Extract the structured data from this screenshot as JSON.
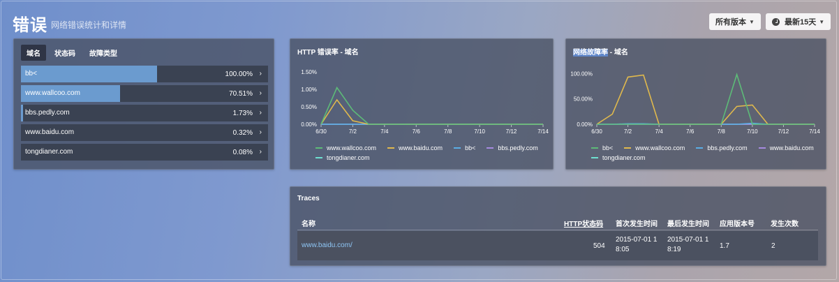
{
  "header": {
    "title": "错误",
    "subtitle": "网络错误统计和详情"
  },
  "controls": {
    "version_label": "所有版本",
    "range_label": "最新15天"
  },
  "domain_panel": {
    "tabs": [
      "域名",
      "状态码",
      "故障类型"
    ],
    "rows": [
      {
        "label": "bb<",
        "percent": "100.00%",
        "fraction": 0.55
      },
      {
        "label": "www.wallcoo.com",
        "percent": "70.51%",
        "fraction": 0.4
      },
      {
        "label": "bbs.pedly.com",
        "percent": "1.73%",
        "fraction": 0.008
      },
      {
        "label": "www.baidu.com",
        "percent": "0.32%",
        "fraction": 0
      },
      {
        "label": "tongdianer.com",
        "percent": "0.08%",
        "fraction": 0
      }
    ]
  },
  "chart_http": {
    "title": "HTTP 错误率 - 域名"
  },
  "chart_net": {
    "title_highlight": "网络故障率",
    "title_rest": " - 域名"
  },
  "chart_data": [
    {
      "type": "line",
      "title": "HTTP 错误率 - 域名",
      "x": [
        "6/30",
        "7/1",
        "7/2",
        "7/3",
        "7/4",
        "7/5",
        "7/6",
        "7/7",
        "7/8",
        "7/9",
        "7/10",
        "7/11",
        "7/12",
        "7/13",
        "7/14"
      ],
      "x_ticks": [
        "6/30",
        "7/2",
        "7/4",
        "7/6",
        "7/8",
        "7/10",
        "7/12",
        "7/14"
      ],
      "y_ticks": [
        "0.00%",
        "0.50%",
        "1.00%",
        "1.50%"
      ],
      "ylim": [
        0,
        1.6
      ],
      "series": [
        {
          "name": "www.wallcoo.com",
          "color": "#5dbb78",
          "values": [
            0,
            1.05,
            0.4,
            0,
            0,
            0,
            0,
            0,
            0,
            0,
            0,
            0,
            0,
            0,
            0
          ]
        },
        {
          "name": "www.baidu.com",
          "color": "#e0b94d",
          "values": [
            0,
            0.7,
            0.1,
            0,
            0,
            0,
            0,
            0,
            0,
            0,
            0,
            0,
            0,
            0,
            0
          ]
        },
        {
          "name": "bb<",
          "color": "#5aaee6",
          "values": [
            0,
            0,
            0,
            0,
            0,
            0,
            0,
            0,
            0,
            0,
            0,
            0,
            0,
            0,
            0
          ]
        },
        {
          "name": "bbs.pedly.com",
          "color": "#a68ae0",
          "values": [
            0,
            0,
            0,
            0,
            0,
            0,
            0,
            0,
            0,
            0,
            0,
            0,
            0,
            0,
            0
          ]
        },
        {
          "name": "tongdianer.com",
          "color": "#6ee0d0",
          "values": [
            0,
            0,
            0,
            0,
            0,
            0,
            0,
            0,
            0,
            0,
            0,
            0,
            0,
            0,
            0
          ]
        }
      ]
    },
    {
      "type": "line",
      "title": "网络故障率 - 域名",
      "x": [
        "6/30",
        "7/1",
        "7/2",
        "7/3",
        "7/4",
        "7/5",
        "7/6",
        "7/7",
        "7/8",
        "7/9",
        "7/10",
        "7/11",
        "7/12",
        "7/13",
        "7/14"
      ],
      "x_ticks": [
        "6/30",
        "7/2",
        "7/4",
        "7/6",
        "7/8",
        "7/10",
        "7/12",
        "7/14"
      ],
      "y_ticks": [
        "0.00%",
        "50.00%",
        "100.00%"
      ],
      "ylim": [
        0,
        110
      ],
      "series": [
        {
          "name": "bb<",
          "color": "#5dbb78",
          "values": [
            0,
            0,
            0,
            0,
            0,
            0,
            0,
            0,
            0,
            98,
            0,
            0,
            0,
            0,
            0
          ]
        },
        {
          "name": "www.wallcoo.com",
          "color": "#e0b94d",
          "values": [
            0,
            20,
            93,
            97,
            0,
            0,
            0,
            0,
            0,
            35,
            38,
            0,
            0,
            0,
            0
          ]
        },
        {
          "name": "bbs.pedly.com",
          "color": "#5aaee6",
          "values": [
            0,
            0,
            1,
            1,
            0,
            0,
            0,
            0,
            0,
            0,
            2,
            0,
            0,
            0,
            0
          ]
        },
        {
          "name": "www.baidu.com",
          "color": "#a68ae0",
          "values": [
            0,
            0,
            0,
            0,
            0,
            0,
            0,
            0,
            0,
            0,
            0,
            0,
            0,
            0,
            0
          ]
        },
        {
          "name": "tongdianer.com",
          "color": "#6ee0d0",
          "values": [
            0,
            0,
            0,
            0,
            0,
            0,
            0,
            0,
            0,
            0,
            0,
            0,
            0,
            0,
            0
          ]
        }
      ]
    }
  ],
  "traces": {
    "title": "Traces",
    "columns": [
      "名称",
      "HTTP状态码",
      "首次发生时间",
      "最后发生时间",
      "应用版本号",
      "发生次数"
    ],
    "rows": [
      {
        "name": "www.baidu.com/",
        "status": "504",
        "first": [
          "2015-07-01 1",
          "8:05"
        ],
        "last": [
          "2015-07-01 1",
          "8:19"
        ],
        "version": "1.7",
        "count": "2"
      }
    ]
  }
}
